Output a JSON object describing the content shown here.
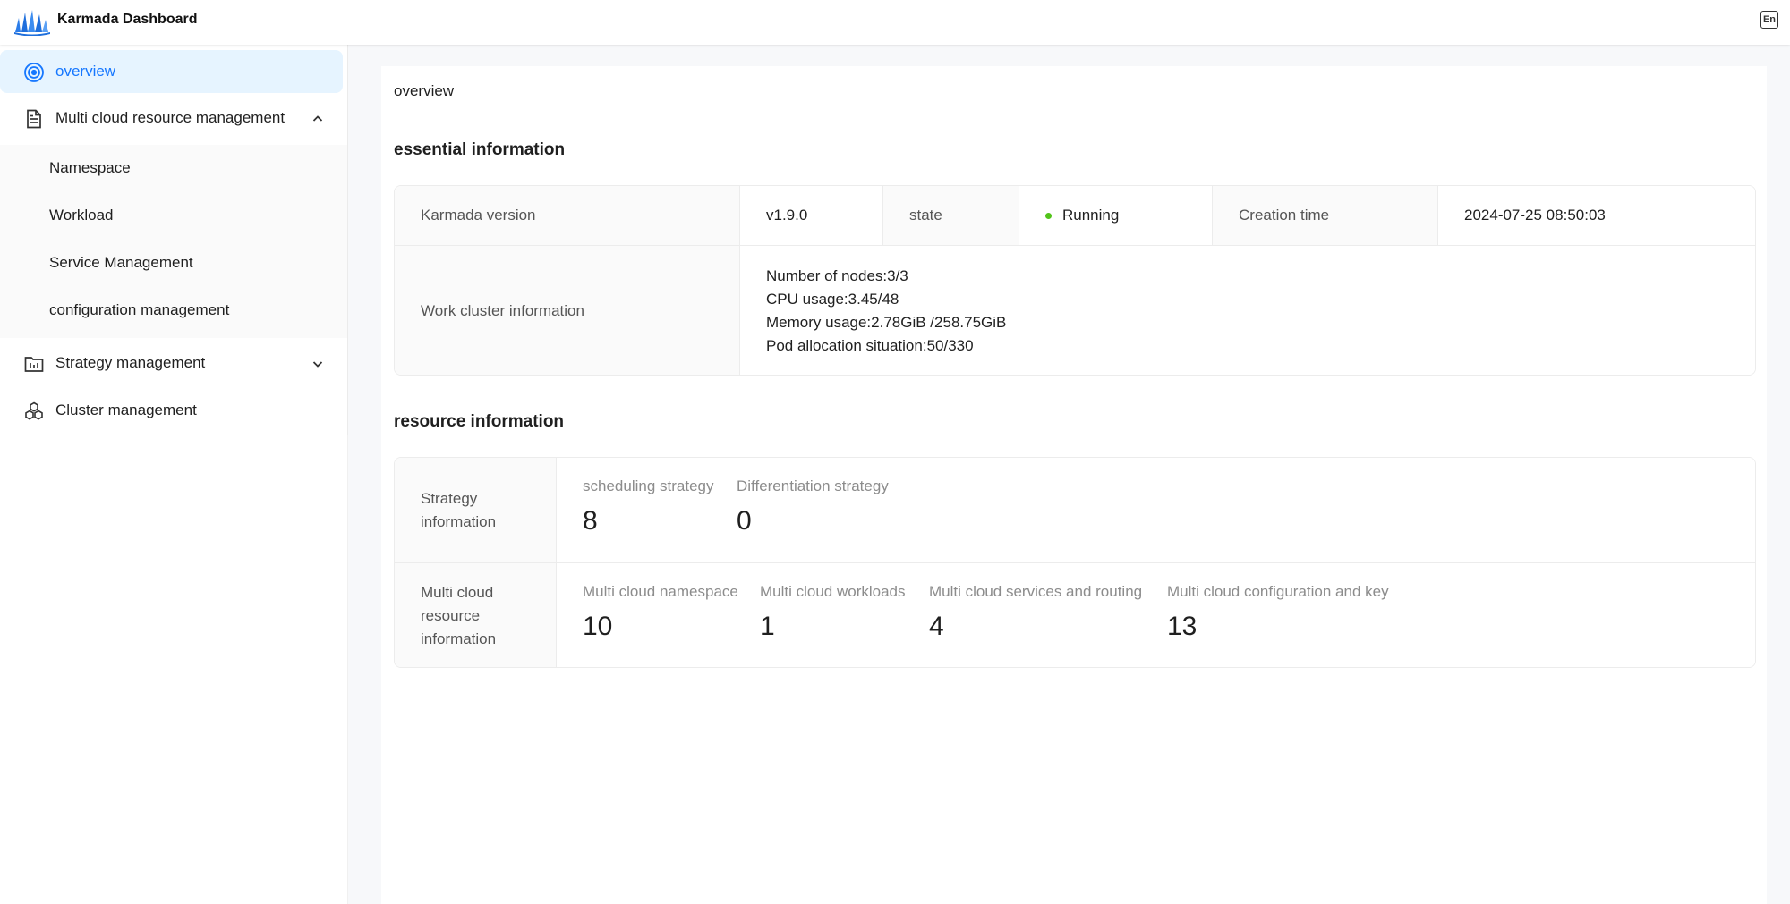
{
  "header": {
    "app_title": "Karmada Dashboard",
    "lang_button": "En"
  },
  "sidebar": {
    "items": [
      {
        "label": "overview",
        "icon": "target-icon",
        "active": true
      },
      {
        "label": "Multi cloud resource management",
        "icon": "document-icon",
        "expanded": true,
        "children": [
          "Namespace",
          "Workload",
          "Service Management",
          "configuration management"
        ]
      },
      {
        "label": "Strategy management",
        "icon": "strategy-icon",
        "expanded": false
      },
      {
        "label": "Cluster management",
        "icon": "cluster-icon"
      }
    ]
  },
  "main": {
    "breadcrumb": "overview",
    "essential": {
      "title": "essential information",
      "karmada_version_label": "Karmada version",
      "karmada_version_value": "v1.9.0",
      "state_label": "state",
      "state_value": "Running",
      "state_color": "#52c41a",
      "creation_time_label": "Creation time",
      "creation_time_value": "2024-07-25 08:50:03",
      "work_cluster_label": "Work cluster information",
      "work_cluster_lines": [
        "Number of nodes:3/3",
        "CPU usage:3.45/48",
        "Memory usage:2.78GiB /258.75GiB",
        "Pod allocation situation:50/330"
      ]
    },
    "resource": {
      "title": "resource information",
      "strategy_label": "Strategy information",
      "strategy_stats": [
        {
          "title": "scheduling strategy",
          "value": "8"
        },
        {
          "title": "Differentiation strategy",
          "value": "0"
        }
      ],
      "multicloud_label": "Multi cloud resource information",
      "multicloud_stats": [
        {
          "title": "Multi cloud namespace",
          "value": "10"
        },
        {
          "title": "Multi cloud workloads",
          "value": "1"
        },
        {
          "title": "Multi cloud services and routing",
          "value": "4"
        },
        {
          "title": "Multi cloud configuration and key",
          "value": "13"
        }
      ]
    }
  }
}
